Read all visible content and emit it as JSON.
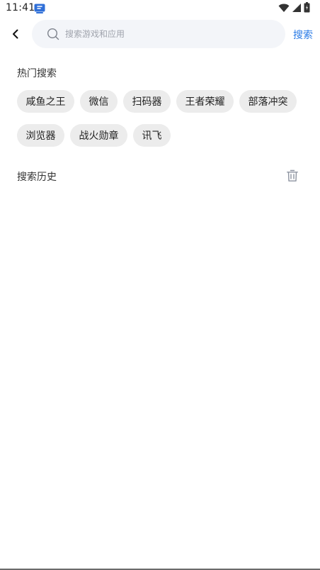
{
  "status_bar": {
    "time": "11:41",
    "icons": [
      "notification-app-icon",
      "wifi-icon",
      "signal-icon",
      "battery-icon"
    ]
  },
  "search": {
    "back_icon": "chevron-left-icon",
    "search_icon": "magnifier-icon",
    "placeholder": "搜索游戏和应用",
    "value": "",
    "submit_label": "搜索",
    "accent_color": "#2a7be6"
  },
  "hot_search": {
    "title": "热门搜索",
    "tags": [
      {
        "label": "咸鱼之王"
      },
      {
        "label": "微信"
      },
      {
        "label": "扫码器"
      },
      {
        "label": "王者荣耀"
      },
      {
        "label": "部落冲突"
      },
      {
        "label": "浏览器"
      },
      {
        "label": "战火勋章"
      },
      {
        "label": "讯飞"
      }
    ]
  },
  "history": {
    "title": "搜索历史",
    "clear_icon": "trash-icon"
  }
}
